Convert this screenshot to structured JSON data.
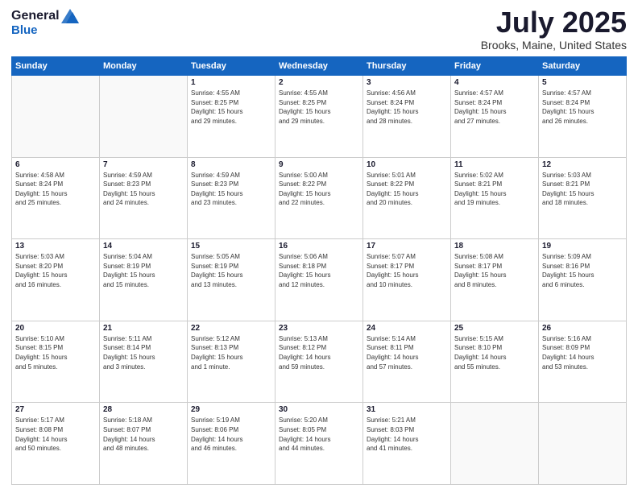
{
  "header": {
    "logo_line1": "General",
    "logo_line2": "Blue",
    "month_title": "July 2025",
    "location": "Brooks, Maine, United States"
  },
  "weekdays": [
    "Sunday",
    "Monday",
    "Tuesday",
    "Wednesday",
    "Thursday",
    "Friday",
    "Saturday"
  ],
  "weeks": [
    [
      {
        "day": "",
        "info": ""
      },
      {
        "day": "",
        "info": ""
      },
      {
        "day": "1",
        "info": "Sunrise: 4:55 AM\nSunset: 8:25 PM\nDaylight: 15 hours\nand 29 minutes."
      },
      {
        "day": "2",
        "info": "Sunrise: 4:55 AM\nSunset: 8:25 PM\nDaylight: 15 hours\nand 29 minutes."
      },
      {
        "day": "3",
        "info": "Sunrise: 4:56 AM\nSunset: 8:24 PM\nDaylight: 15 hours\nand 28 minutes."
      },
      {
        "day": "4",
        "info": "Sunrise: 4:57 AM\nSunset: 8:24 PM\nDaylight: 15 hours\nand 27 minutes."
      },
      {
        "day": "5",
        "info": "Sunrise: 4:57 AM\nSunset: 8:24 PM\nDaylight: 15 hours\nand 26 minutes."
      }
    ],
    [
      {
        "day": "6",
        "info": "Sunrise: 4:58 AM\nSunset: 8:24 PM\nDaylight: 15 hours\nand 25 minutes."
      },
      {
        "day": "7",
        "info": "Sunrise: 4:59 AM\nSunset: 8:23 PM\nDaylight: 15 hours\nand 24 minutes."
      },
      {
        "day": "8",
        "info": "Sunrise: 4:59 AM\nSunset: 8:23 PM\nDaylight: 15 hours\nand 23 minutes."
      },
      {
        "day": "9",
        "info": "Sunrise: 5:00 AM\nSunset: 8:22 PM\nDaylight: 15 hours\nand 22 minutes."
      },
      {
        "day": "10",
        "info": "Sunrise: 5:01 AM\nSunset: 8:22 PM\nDaylight: 15 hours\nand 20 minutes."
      },
      {
        "day": "11",
        "info": "Sunrise: 5:02 AM\nSunset: 8:21 PM\nDaylight: 15 hours\nand 19 minutes."
      },
      {
        "day": "12",
        "info": "Sunrise: 5:03 AM\nSunset: 8:21 PM\nDaylight: 15 hours\nand 18 minutes."
      }
    ],
    [
      {
        "day": "13",
        "info": "Sunrise: 5:03 AM\nSunset: 8:20 PM\nDaylight: 15 hours\nand 16 minutes."
      },
      {
        "day": "14",
        "info": "Sunrise: 5:04 AM\nSunset: 8:19 PM\nDaylight: 15 hours\nand 15 minutes."
      },
      {
        "day": "15",
        "info": "Sunrise: 5:05 AM\nSunset: 8:19 PM\nDaylight: 15 hours\nand 13 minutes."
      },
      {
        "day": "16",
        "info": "Sunrise: 5:06 AM\nSunset: 8:18 PM\nDaylight: 15 hours\nand 12 minutes."
      },
      {
        "day": "17",
        "info": "Sunrise: 5:07 AM\nSunset: 8:17 PM\nDaylight: 15 hours\nand 10 minutes."
      },
      {
        "day": "18",
        "info": "Sunrise: 5:08 AM\nSunset: 8:17 PM\nDaylight: 15 hours\nand 8 minutes."
      },
      {
        "day": "19",
        "info": "Sunrise: 5:09 AM\nSunset: 8:16 PM\nDaylight: 15 hours\nand 6 minutes."
      }
    ],
    [
      {
        "day": "20",
        "info": "Sunrise: 5:10 AM\nSunset: 8:15 PM\nDaylight: 15 hours\nand 5 minutes."
      },
      {
        "day": "21",
        "info": "Sunrise: 5:11 AM\nSunset: 8:14 PM\nDaylight: 15 hours\nand 3 minutes."
      },
      {
        "day": "22",
        "info": "Sunrise: 5:12 AM\nSunset: 8:13 PM\nDaylight: 15 hours\nand 1 minute."
      },
      {
        "day": "23",
        "info": "Sunrise: 5:13 AM\nSunset: 8:12 PM\nDaylight: 14 hours\nand 59 minutes."
      },
      {
        "day": "24",
        "info": "Sunrise: 5:14 AM\nSunset: 8:11 PM\nDaylight: 14 hours\nand 57 minutes."
      },
      {
        "day": "25",
        "info": "Sunrise: 5:15 AM\nSunset: 8:10 PM\nDaylight: 14 hours\nand 55 minutes."
      },
      {
        "day": "26",
        "info": "Sunrise: 5:16 AM\nSunset: 8:09 PM\nDaylight: 14 hours\nand 53 minutes."
      }
    ],
    [
      {
        "day": "27",
        "info": "Sunrise: 5:17 AM\nSunset: 8:08 PM\nDaylight: 14 hours\nand 50 minutes."
      },
      {
        "day": "28",
        "info": "Sunrise: 5:18 AM\nSunset: 8:07 PM\nDaylight: 14 hours\nand 48 minutes."
      },
      {
        "day": "29",
        "info": "Sunrise: 5:19 AM\nSunset: 8:06 PM\nDaylight: 14 hours\nand 46 minutes."
      },
      {
        "day": "30",
        "info": "Sunrise: 5:20 AM\nSunset: 8:05 PM\nDaylight: 14 hours\nand 44 minutes."
      },
      {
        "day": "31",
        "info": "Sunrise: 5:21 AM\nSunset: 8:03 PM\nDaylight: 14 hours\nand 41 minutes."
      },
      {
        "day": "",
        "info": ""
      },
      {
        "day": "",
        "info": ""
      }
    ]
  ]
}
